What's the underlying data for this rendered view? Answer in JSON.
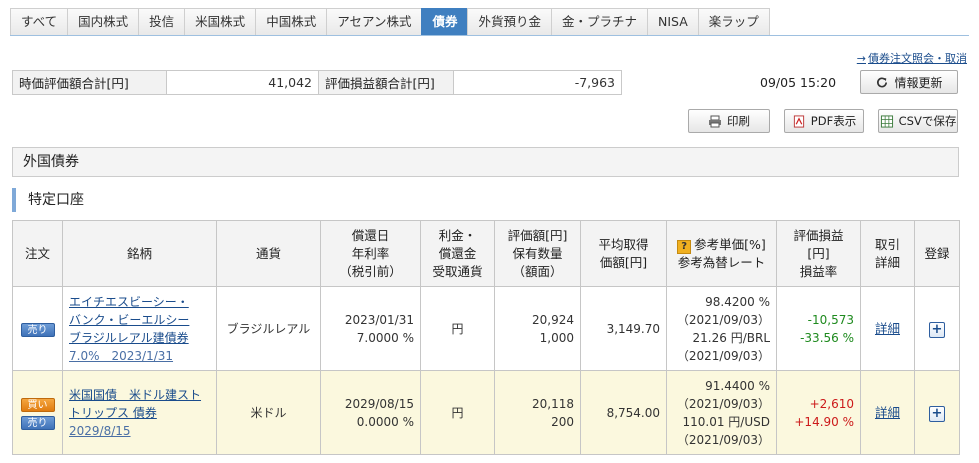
{
  "tabs": [
    "すべて",
    "国内株式",
    "投信",
    "米国株式",
    "中国株式",
    "アセアン株式",
    "債券",
    "外貨預り金",
    "金・プラチナ",
    "NISA",
    "楽ラップ"
  ],
  "active_tab": "債券",
  "links": {
    "bond_order_cancel": "債券注文照会・取消"
  },
  "summary": {
    "market_value_label": "時価評価額合計[円]",
    "market_value": "41,042",
    "pnl_label": "評価損益額合計[円]",
    "pnl": "-7,963"
  },
  "datetime": "09/05 15:20",
  "buttons": {
    "refresh": "情報更新",
    "print": "印刷",
    "pdf": "PDF表示",
    "csv": "CSVで保存"
  },
  "section_title": "外国債券",
  "account_title": "特定口座",
  "table": {
    "headers": {
      "order": "注文",
      "name": "銘柄",
      "currency": "通貨",
      "redemption": [
        "償還日",
        "年利率",
        "（税引前）"
      ],
      "interest": [
        "利金・",
        "償還金",
        "受取通貨"
      ],
      "valuation": [
        "評価額[円]",
        "保有数量",
        "（額面）"
      ],
      "avg_price": [
        "平均取得",
        "価額[円]"
      ],
      "ref_price": [
        "参考単価[%]",
        "参考為替レート"
      ],
      "pnl": [
        "評価損益",
        "[円]",
        "損益率"
      ],
      "trade": [
        "取引",
        "詳細"
      ],
      "register": "登録"
    },
    "rows": [
      {
        "badges": [
          "売り"
        ],
        "name_lines": [
          "エイチエスビーシー・",
          "バンク・ビーエルシー",
          "ブラジルレアル建債券"
        ],
        "name_tail": "7.0%　2023/1/31",
        "currency": "ブラジルレアル",
        "redemption_date": "2023/01/31",
        "rate": "7.0000 %",
        "interest_currency": "円",
        "valuation": "20,924",
        "quantity": "1,000",
        "avg_price": "3,149.70",
        "ref_price": "98.4200 %",
        "ref_price_date": "（2021/09/03）",
        "fx_rate": "21.26 円/BRL",
        "fx_date": "（2021/09/03）",
        "pnl": "-10,573",
        "pnl_rate": "-33.56 %",
        "detail": "詳細",
        "register": "+"
      },
      {
        "badges": [
          "買い",
          "売り"
        ],
        "name_lines": [
          "米国国債　米ドル建スト",
          "トリップス 債券"
        ],
        "name_tail": "2029/8/15",
        "currency": "米ドル",
        "redemption_date": "2029/08/15",
        "rate": "0.0000 %",
        "interest_currency": "円",
        "valuation": "20,118",
        "quantity": "200",
        "avg_price": "8,754.00",
        "ref_price": "91.4400 %",
        "ref_price_date": "（2021/09/03）",
        "fx_rate": "110.01 円/USD",
        "fx_date": "（2021/09/03）",
        "pnl": "+2,610",
        "pnl_rate": "+14.90 %",
        "detail": "詳細",
        "register": "+"
      }
    ]
  },
  "icons": {
    "refresh": "refresh-icon",
    "print": "printer-icon",
    "pdf": "pdf-icon",
    "csv": "csv-icon",
    "help": "question-icon"
  },
  "colors": {
    "active_tab": "#3f7fc0",
    "positive": "#cc1a1a",
    "negative": "#1e8a1e",
    "row_highlight": "#fbf8de"
  }
}
